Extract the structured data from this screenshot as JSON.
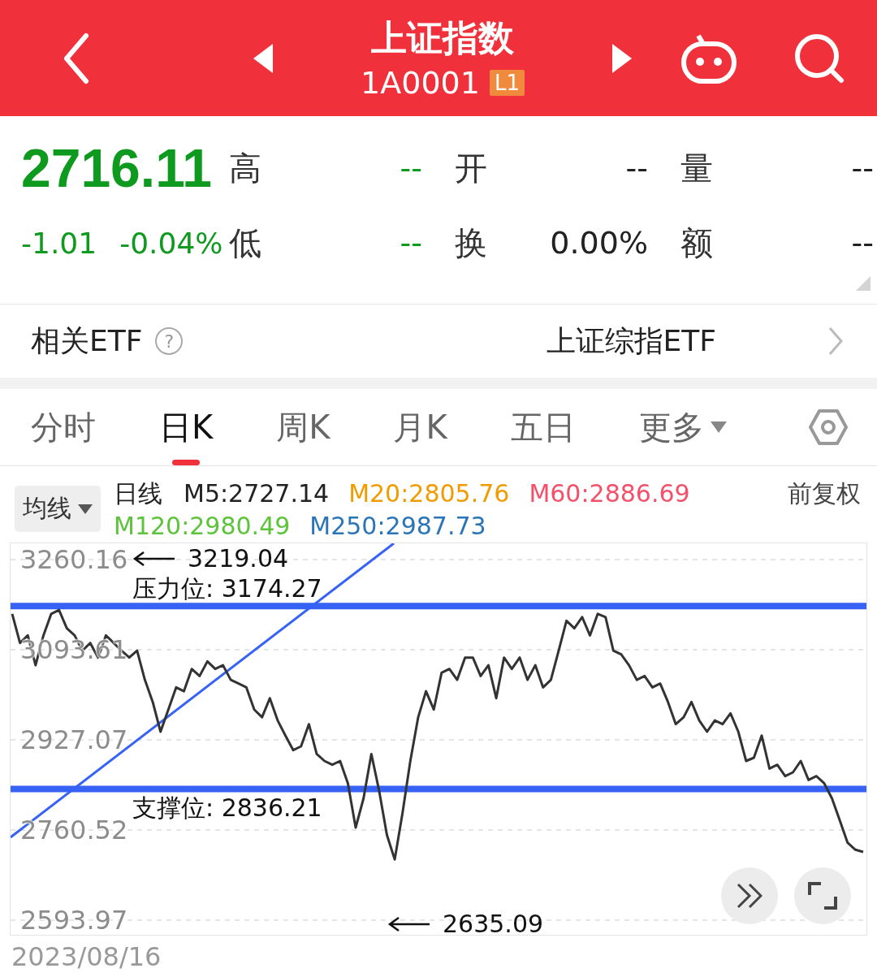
{
  "header": {
    "title": "上证指数",
    "code": "1A0001",
    "badge": "L1"
  },
  "quote": {
    "price": "2716.11",
    "change": "-1.01",
    "change_pct": "-0.04%"
  },
  "stats": [
    {
      "label": "高",
      "value": "--",
      "kind": "down"
    },
    {
      "label": "开",
      "value": "--",
      "kind": "flat"
    },
    {
      "label": "量",
      "value": "--",
      "kind": "flat"
    },
    {
      "label": "低",
      "value": "--",
      "kind": "down"
    },
    {
      "label": "换",
      "value": "0.00%",
      "kind": "flat"
    },
    {
      "label": "额",
      "value": "--",
      "kind": "flat"
    }
  ],
  "etf": {
    "label": "相关ETF",
    "help": "?",
    "value": "上证综指ETF"
  },
  "tabs": [
    {
      "label": "分时",
      "selected": false,
      "dropdown": false
    },
    {
      "label": "日K",
      "selected": true,
      "dropdown": false
    },
    {
      "label": "周K",
      "selected": false,
      "dropdown": false
    },
    {
      "label": "月K",
      "selected": false,
      "dropdown": false
    },
    {
      "label": "五日",
      "selected": false,
      "dropdown": false
    },
    {
      "label": "更多",
      "selected": false,
      "dropdown": true
    }
  ],
  "indicators": {
    "selector": "均线",
    "line_type": "日线",
    "averages": [
      {
        "label": "M5:2727.14",
        "color": "#222222"
      },
      {
        "label": "M20:2805.76",
        "color": "#f29b00"
      },
      {
        "label": "M60:2886.69",
        "color": "#f5506a"
      },
      {
        "label": "M120:2980.49",
        "color": "#5cc43a"
      },
      {
        "label": "M250:2987.73",
        "color": "#2a75b8"
      }
    ],
    "adjust": "前复权"
  },
  "chart": {
    "chart_data": {
      "type": "line",
      "grid": true,
      "ylim": [
        2593.97,
        3260.16
      ],
      "ref_lines": [
        {
          "axis": "y",
          "value": 3174.27,
          "label": "压力位: 3174.27"
        },
        {
          "axis": "y",
          "value": 2836.21,
          "label": "支撑位: 2836.21"
        }
      ],
      "yticks": [
        3260.16,
        3093.61,
        2927.07,
        2760.52,
        2593.97
      ],
      "series": [
        {
          "color": "#333333",
          "values": [
            3160,
            3106,
            3120,
            3065,
            3120,
            3160,
            3167,
            3133,
            3120,
            3092,
            3106,
            3079,
            3120,
            3106,
            3092,
            3079,
            3092,
            3038,
            2997,
            2942,
            2983,
            3024,
            3017,
            3058,
            3045,
            3072,
            3058,
            3065,
            3038,
            3031,
            3024,
            2983,
            2969,
            3004,
            2963,
            2935,
            2908,
            2915,
            2956,
            2901,
            2888,
            2881,
            2888,
            2847,
            2765,
            2819,
            2901,
            2833,
            2751,
            2706,
            2792,
            2888,
            2969,
            3017,
            2983,
            3051,
            3058,
            3038,
            3079,
            3079,
            3045,
            3065,
            3004,
            3079,
            3058,
            3079,
            3038,
            3065,
            3024,
            3038,
            3092,
            3147,
            3133,
            3154,
            3120,
            3160,
            3154,
            3092,
            3085,
            3065,
            3038,
            3045,
            3024,
            3031,
            2997,
            2956,
            2969,
            2997,
            2963,
            2942,
            2963,
            2956,
            2976,
            2942,
            2888,
            2894,
            2935,
            2874,
            2881,
            2860,
            2867,
            2888,
            2853,
            2860,
            2847,
            2819,
            2778,
            2737,
            2724,
            2720
          ]
        }
      ]
    },
    "high_marker": "3219.04",
    "low_marker": "2635.09",
    "start_date": "2023/08/16"
  }
}
